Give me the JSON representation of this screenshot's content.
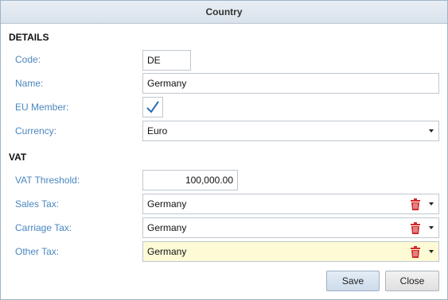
{
  "title": "Country",
  "details": {
    "heading": "DETAILS",
    "code_label": "Code:",
    "code_value": "DE",
    "name_label": "Name:",
    "name_value": "Germany",
    "eu_label": "EU Member:",
    "eu_checked": true,
    "currency_label": "Currency:",
    "currency_value": "Euro"
  },
  "vat": {
    "heading": "VAT",
    "threshold_label": "VAT Threshold:",
    "threshold_value": "100,000.00",
    "sales_label": "Sales Tax:",
    "sales_value": "Germany",
    "carriage_label": "Carriage Tax:",
    "carriage_value": "Germany",
    "other_label": "Other Tax:",
    "other_value": "Germany"
  },
  "buttons": {
    "save": "Save",
    "close": "Close"
  },
  "icons": {
    "check": "checkmark-icon",
    "trash": "trash-icon",
    "dropdown": "chevron-down-icon"
  },
  "colors": {
    "label": "#4a86c0",
    "check": "#2a6db2",
    "trash": "#d22a2a",
    "highlight_field": "#fdfbd6"
  }
}
